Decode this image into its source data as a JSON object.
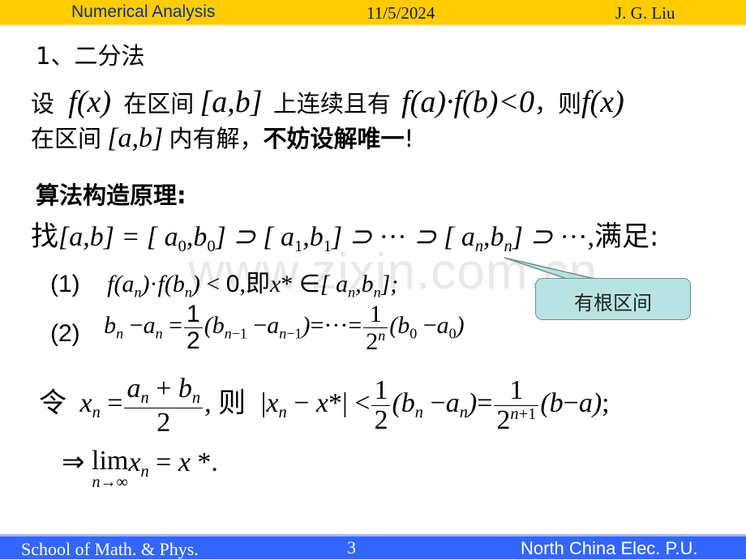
{
  "header": {
    "course": "Numerical Analysis",
    "date": "11/5/2024",
    "author": "J. G. Liu"
  },
  "footer": {
    "school": "School of Math. & Phys.",
    "page_number": "3",
    "university": "North China Elec. P.U."
  },
  "slide": {
    "section_title": "1、二分法",
    "intro": {
      "p1_she": "设",
      "fx": "f(x)",
      "in_interval": "在区间",
      "interval": "[a,b]",
      "continuous": "上连续且有",
      "condition": "f(a)·f(b)<0",
      "comma_then": "，则",
      "fx2": "f(x)",
      "p2_in_interval": "在区间",
      "interval2": "[a,b]",
      "has_solution": "内有解，",
      "assume_unique": "不妨设解唯一",
      "exclaim": "!"
    },
    "principle_heading": "算法构造原理:",
    "find_line": {
      "find": "找",
      "chain_text": "[a,b] = [a0,b0] ⊃ [a1,b1] ⊃ ··· ⊃ [an,bn] ⊃ ···,",
      "satisfy": "满足:"
    },
    "cond1": {
      "label": "(1)",
      "expr": "f(an)·f(bn) < 0,",
      "ie": "即",
      "expr2": "x* ∈ [an,bn];"
    },
    "cond2": {
      "label": "(2)",
      "expr": "bn − an = 1/2 (bn−1 − an−1) = ··· = 1/2^n (b0 − a0)"
    },
    "let_line": {
      "let": "令",
      "xn_def": "xn = (an + bn)/2,",
      "then": "则",
      "bound": "|xn − x*| < 1/2 (bn − an) = 1/2^(n+1) (b − a);"
    },
    "limit_line": "⇒ lim(n→∞) xn = x*.",
    "callout": "有根区间",
    "watermark": "www.zixin.com.cn"
  },
  "colors": {
    "header_bg": "#ffcc00",
    "header_text": "#1a2e6e",
    "footer_bg": "#3366ff",
    "callout_bg": "#b9e3e3"
  }
}
